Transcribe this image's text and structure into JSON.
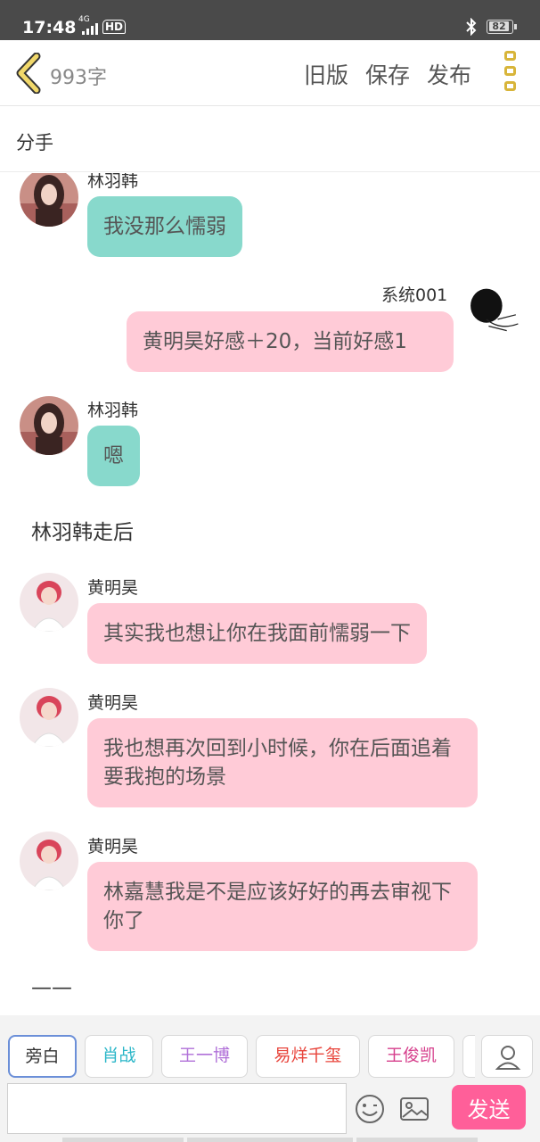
{
  "status_bar": {
    "time": "17:48",
    "network": "4G",
    "hd": "HD",
    "battery": "82"
  },
  "top_bar": {
    "word_count": "993字",
    "actions": [
      "旧版",
      "保存",
      "发布"
    ]
  },
  "story_title": "分手",
  "messages": [
    {
      "sender": "林羽韩",
      "text": "我没那么懦弱",
      "side": "left",
      "color": "teal"
    },
    {
      "sender": "系统001",
      "text": "黄明昊好感＋20，当前好感1",
      "side": "right",
      "color": "pink"
    },
    {
      "sender": "林羽韩",
      "text": "嗯",
      "side": "left",
      "color": "teal"
    },
    {
      "narration": "林羽韩走后"
    },
    {
      "sender": "黄明昊",
      "text": "其实我也想让你在我面前懦弱一下",
      "side": "left",
      "color": "pink"
    },
    {
      "sender": "黄明昊",
      "text": "我也想再次回到小时候，你在后面追着要我抱的场景",
      "side": "left",
      "color": "pink"
    },
    {
      "sender": "黄明昊",
      "text": "林嘉慧我是不是应该好好的再去审视下你了",
      "side": "left",
      "color": "pink"
    },
    {
      "narration": "——"
    }
  ],
  "characters": [
    {
      "name": "旁白",
      "color": "#666666"
    },
    {
      "name": "肖战",
      "color": "#2ab6c8"
    },
    {
      "name": "王一博",
      "color": "#b070d8"
    },
    {
      "name": "易烊千玺",
      "color": "#e8453c"
    },
    {
      "name": "王俊凯",
      "color": "#d63f8c"
    }
  ],
  "composer": {
    "input_value": "",
    "send_label": "发送"
  },
  "colors": {
    "teal_bubble": "#88d9cc",
    "pink_bubble": "#ffcbd7",
    "send_button": "#ff5f99",
    "accent_yellow": "#d8b53a"
  }
}
